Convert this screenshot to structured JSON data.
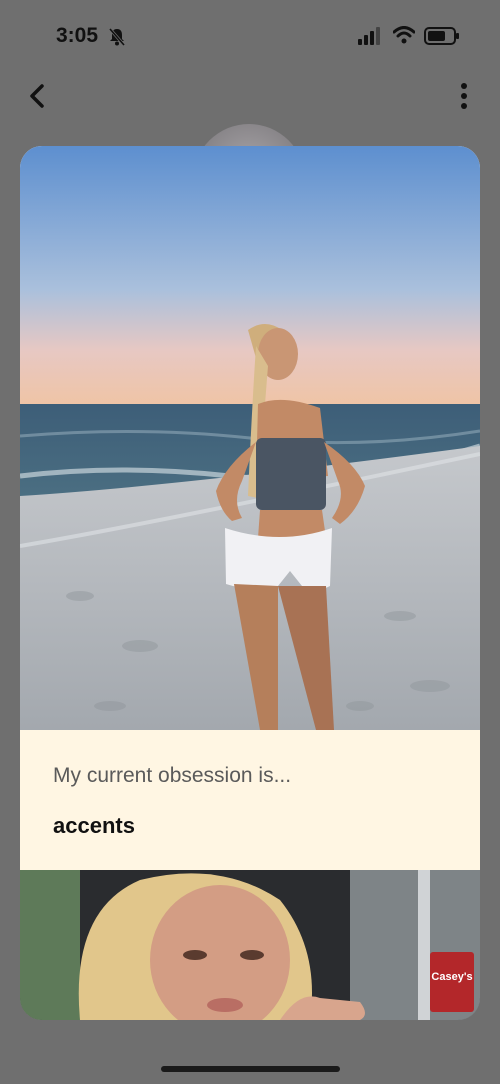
{
  "status": {
    "time": "3:05"
  },
  "prompt": {
    "question": "My current obsession is...",
    "answer": "accents"
  },
  "second_photo": {
    "sign_text": "Casey's"
  },
  "icons": {
    "back": "chevron-left-icon",
    "more": "more-vertical-icon",
    "bell": "bell-slash-icon",
    "signal": "cellular-signal-icon",
    "wifi": "wifi-icon",
    "battery": "battery-icon"
  },
  "colors": {
    "overlay": "#6f6f6f",
    "prompt_bg": "#fff6e3"
  }
}
